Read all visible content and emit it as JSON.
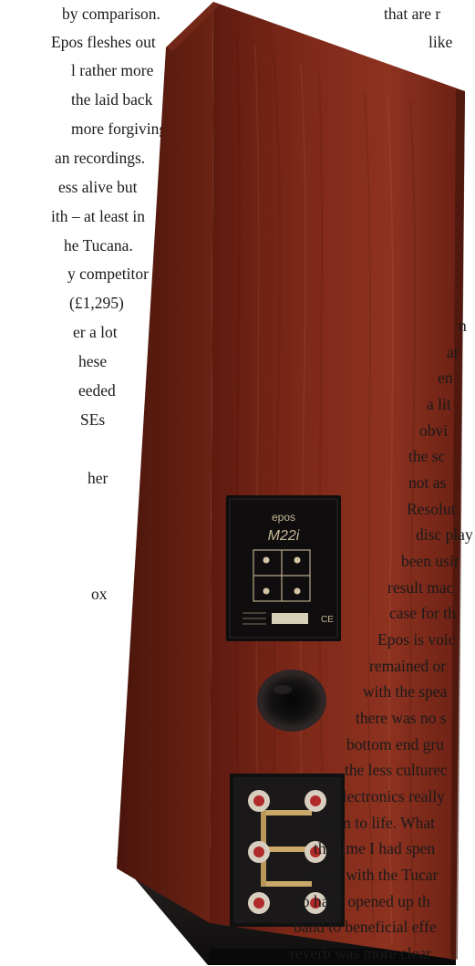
{
  "left_column": [
    "by comparison.",
    "Epos fleshes out",
    "l rather more",
    "the laid back",
    "more forgiving",
    "an recordings.",
    "ess alive but",
    "ith – at least in",
    "he Tucana.",
    "y competitor",
    "(£1,295)",
    "er a lot",
    "hese",
    "eeded",
    "SEs",
    "",
    "her",
    "",
    "",
    "",
    "ox"
  ],
  "right_top": [
    "that are r",
    "like"
  ],
  "right_column": [
    "n",
    "ar",
    "en",
    "a lit",
    "obvi",
    "the sc",
    "not as",
    "Resolut",
    "disc play",
    "been usir",
    "result mac",
    "case for th",
    "Epos is voic",
    "remained or",
    "with the spea",
    "there was no s",
    "bottom end gru",
    "the less culturec",
    "electronics really",
    "them to life. What",
    "the time I had spen",
    "them with the Tucar",
    "to have opened up th",
    "band to beneficial effe",
    "reverb was more clear"
  ],
  "speaker_label": {
    "brand": "epos",
    "model": "M22i",
    "badge_text": "CE"
  },
  "colors": {
    "wood_front": "#7a2416",
    "wood_side": "#5a1a0f",
    "wood_highlight": "#9a3a22",
    "plinth": "#1c1a1a",
    "panel": "#121010",
    "terminal_brass": "#c9a86a"
  }
}
